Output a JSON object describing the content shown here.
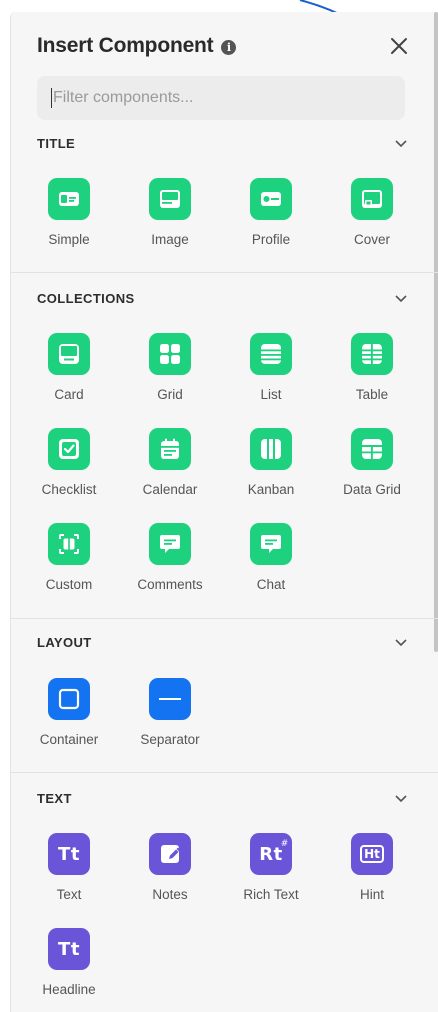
{
  "header": {
    "title": "Insert Component",
    "info_icon": "info-icon",
    "close_icon": "close-icon"
  },
  "search": {
    "placeholder": "Filter components...",
    "value": ""
  },
  "colors": {
    "green": "#1ed17e",
    "blue": "#1473f0",
    "purple": "#6a55d9",
    "panel_bg": "#f6f6f6"
  },
  "sections": [
    {
      "title": "TITLE",
      "items": [
        {
          "label": "Simple",
          "icon": "simple-title-icon"
        },
        {
          "label": "Image",
          "icon": "image-title-icon"
        },
        {
          "label": "Profile",
          "icon": "profile-title-icon"
        },
        {
          "label": "Cover",
          "icon": "cover-title-icon"
        }
      ]
    },
    {
      "title": "COLLECTIONS",
      "items": [
        {
          "label": "Card",
          "icon": "card-icon"
        },
        {
          "label": "Grid",
          "icon": "grid-icon"
        },
        {
          "label": "List",
          "icon": "list-icon"
        },
        {
          "label": "Table",
          "icon": "table-icon"
        },
        {
          "label": "Checklist",
          "icon": "checklist-icon"
        },
        {
          "label": "Calendar",
          "icon": "calendar-icon"
        },
        {
          "label": "Kanban",
          "icon": "kanban-icon"
        },
        {
          "label": "Data Grid",
          "icon": "data-grid-icon"
        },
        {
          "label": "Custom",
          "icon": "custom-icon"
        },
        {
          "label": "Comments",
          "icon": "comments-icon"
        },
        {
          "label": "Chat",
          "icon": "chat-icon"
        }
      ]
    },
    {
      "title": "LAYOUT",
      "items": [
        {
          "label": "Container",
          "icon": "container-icon"
        },
        {
          "label": "Separator",
          "icon": "separator-icon"
        }
      ]
    },
    {
      "title": "TEXT",
      "items": [
        {
          "label": "Text",
          "icon": "text-icon",
          "glyph": "Tt"
        },
        {
          "label": "Notes",
          "icon": "notes-icon"
        },
        {
          "label": "Rich Text",
          "icon": "rich-text-icon",
          "glyph": "Rt",
          "sup": "#"
        },
        {
          "label": "Hint",
          "icon": "hint-icon",
          "glyph": "Ht"
        },
        {
          "label": "Headline",
          "icon": "headline-icon",
          "glyph": "Tt"
        }
      ]
    }
  ]
}
